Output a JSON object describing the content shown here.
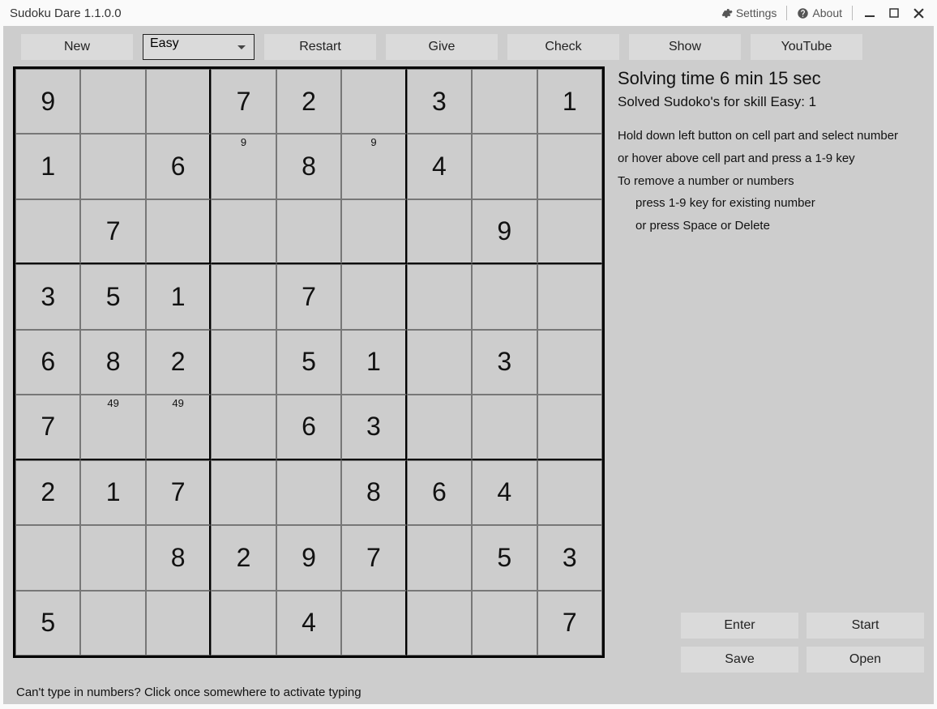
{
  "window": {
    "title": "Sudoku Dare 1.1.0.0",
    "settings": "Settings",
    "about": "About"
  },
  "toolbar": {
    "new": "New",
    "difficulty": "Easy",
    "restart": "Restart",
    "give": "Give",
    "check": "Check",
    "show": "Show",
    "youtube": "YouTube"
  },
  "status": {
    "time_label": "Solving time 6 min 15 sec",
    "solved_label": "Solved Sudoko's for skill Easy: 1"
  },
  "help": {
    "l1": "Hold down left button on cell part and select number",
    "l2": "or hover above cell part and press a 1-9 key",
    "l3": "To remove a number or numbers",
    "l4": "press 1-9 key for existing number",
    "l5": "or press Space or Delete"
  },
  "side_buttons": {
    "enter": "Enter",
    "start": "Start",
    "save": "Save",
    "open": "Open"
  },
  "footer": "Can't type in numbers? Click once somewhere to activate typing",
  "board": [
    [
      {
        "v": "9"
      },
      {
        "v": ""
      },
      {
        "v": ""
      },
      {
        "v": "7"
      },
      {
        "v": "2"
      },
      {
        "v": ""
      },
      {
        "v": "3"
      },
      {
        "v": ""
      },
      {
        "v": "1"
      }
    ],
    [
      {
        "v": "1"
      },
      {
        "v": ""
      },
      {
        "v": "6"
      },
      {
        "v": "",
        "p": "9"
      },
      {
        "v": "8"
      },
      {
        "v": "",
        "p": "9"
      },
      {
        "v": "4"
      },
      {
        "v": ""
      },
      {
        "v": ""
      }
    ],
    [
      {
        "v": ""
      },
      {
        "v": "7"
      },
      {
        "v": ""
      },
      {
        "v": ""
      },
      {
        "v": ""
      },
      {
        "v": ""
      },
      {
        "v": ""
      },
      {
        "v": "9"
      },
      {
        "v": ""
      }
    ],
    [
      {
        "v": "3"
      },
      {
        "v": "5"
      },
      {
        "v": "1"
      },
      {
        "v": ""
      },
      {
        "v": "7"
      },
      {
        "v": ""
      },
      {
        "v": ""
      },
      {
        "v": ""
      },
      {
        "v": ""
      }
    ],
    [
      {
        "v": "6"
      },
      {
        "v": "8"
      },
      {
        "v": "2"
      },
      {
        "v": ""
      },
      {
        "v": "5"
      },
      {
        "v": "1"
      },
      {
        "v": ""
      },
      {
        "v": "3"
      },
      {
        "v": ""
      }
    ],
    [
      {
        "v": "7"
      },
      {
        "v": "",
        "p": "49"
      },
      {
        "v": "",
        "p": "49"
      },
      {
        "v": ""
      },
      {
        "v": "6"
      },
      {
        "v": "3"
      },
      {
        "v": ""
      },
      {
        "v": ""
      },
      {
        "v": ""
      }
    ],
    [
      {
        "v": "2"
      },
      {
        "v": "1"
      },
      {
        "v": "7"
      },
      {
        "v": ""
      },
      {
        "v": ""
      },
      {
        "v": "8"
      },
      {
        "v": "6"
      },
      {
        "v": "4"
      },
      {
        "v": ""
      }
    ],
    [
      {
        "v": ""
      },
      {
        "v": ""
      },
      {
        "v": "8"
      },
      {
        "v": "2"
      },
      {
        "v": "9"
      },
      {
        "v": "7"
      },
      {
        "v": ""
      },
      {
        "v": "5"
      },
      {
        "v": "3"
      }
    ],
    [
      {
        "v": "5"
      },
      {
        "v": ""
      },
      {
        "v": ""
      },
      {
        "v": ""
      },
      {
        "v": "4"
      },
      {
        "v": ""
      },
      {
        "v": ""
      },
      {
        "v": ""
      },
      {
        "v": "7"
      }
    ]
  ]
}
